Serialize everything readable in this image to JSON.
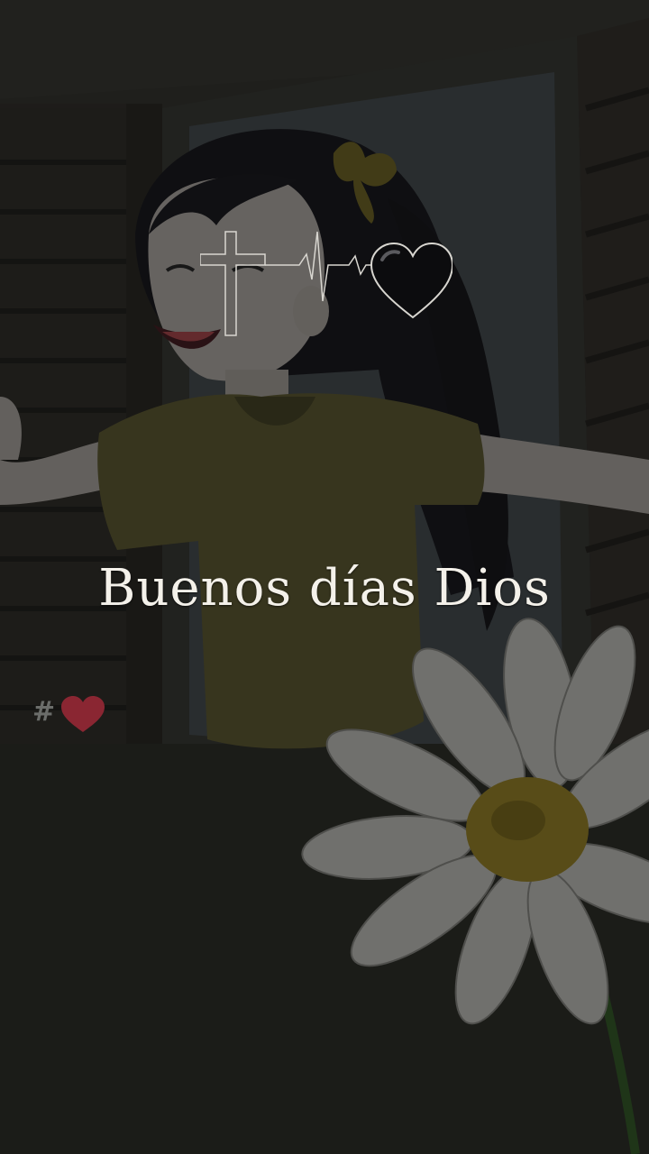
{
  "video": {
    "caption": "Buenos días Dios"
  },
  "overlay": {
    "emblem_icon": "cross-heartbeat-heart-icon",
    "hashtag_text": "#",
    "hashtag_icon": "red-heart-icon"
  },
  "colors": {
    "background": "#22231f",
    "shirt": "#4d4a2a",
    "daisy_center": "#7a6a22",
    "caption_text": "#f4f1ea",
    "heart_red": "#c02a3a"
  }
}
